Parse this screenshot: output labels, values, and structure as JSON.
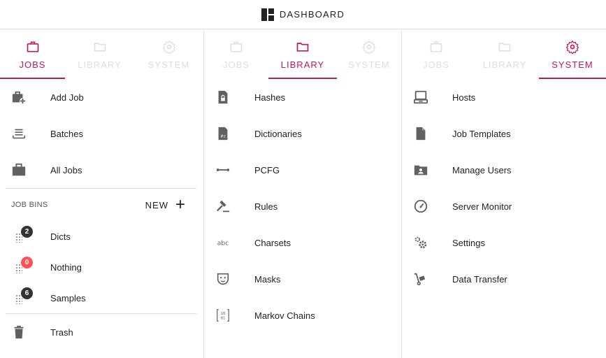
{
  "header": {
    "title": "DASHBOARD",
    "icon": "dashboard-icon"
  },
  "colors": {
    "accent": "#c2185b",
    "badge_dark": "#333333",
    "badge_zero": "#ff5252",
    "icon_gray": "#616161",
    "inactive_tab": "#e0e0e0"
  },
  "panels": [
    {
      "tabs": [
        {
          "label": "JOBS",
          "icon": "briefcase-icon",
          "active": true
        },
        {
          "label": "LIBRARY",
          "icon": "folder-icon",
          "active": false
        },
        {
          "label": "SYSTEM",
          "icon": "gear-icon",
          "active": false
        }
      ],
      "items": [
        {
          "label": "Add Job",
          "icon": "add-job-icon"
        },
        {
          "label": "Batches",
          "icon": "batches-icon"
        },
        {
          "label": "All Jobs",
          "icon": "briefcase-icon"
        }
      ],
      "job_bins": {
        "title": "JOB BINS",
        "new_label": "NEW",
        "bins": [
          {
            "label": "Dicts",
            "count": "2"
          },
          {
            "label": "Nothing",
            "count": "0"
          },
          {
            "label": "Samples",
            "count": "6"
          }
        ]
      },
      "trash": {
        "label": "Trash",
        "icon": "trash-icon"
      }
    },
    {
      "tabs": [
        {
          "label": "JOBS",
          "icon": "briefcase-icon",
          "active": false
        },
        {
          "label": "LIBRARY",
          "icon": "folder-icon",
          "active": true
        },
        {
          "label": "SYSTEM",
          "icon": "gear-icon",
          "active": false
        }
      ],
      "items": [
        {
          "label": "Hashes",
          "icon": "hash-file-icon"
        },
        {
          "label": "Dictionaries",
          "icon": "dictionary-file-icon"
        },
        {
          "label": "PCFG",
          "icon": "pcfg-icon"
        },
        {
          "label": "Rules",
          "icon": "gavel-icon"
        },
        {
          "label": "Charsets",
          "icon": "charset-icon"
        },
        {
          "label": "Masks",
          "icon": "mask-icon"
        },
        {
          "label": "Markov Chains",
          "icon": "markov-matrix-icon"
        }
      ]
    },
    {
      "tabs": [
        {
          "label": "JOBS",
          "icon": "briefcase-icon",
          "active": false
        },
        {
          "label": "LIBRARY",
          "icon": "folder-icon",
          "active": false
        },
        {
          "label": "SYSTEM",
          "icon": "gear-icon",
          "active": true
        }
      ],
      "items": [
        {
          "label": "Hosts",
          "icon": "laptop-icon"
        },
        {
          "label": "Job Templates",
          "icon": "file-icon"
        },
        {
          "label": "Manage Users",
          "icon": "user-folder-icon"
        },
        {
          "label": "Server Monitor",
          "icon": "gauge-icon"
        },
        {
          "label": "Settings",
          "icon": "settings-icon"
        },
        {
          "label": "Data Transfer",
          "icon": "dolly-icon"
        }
      ]
    }
  ]
}
